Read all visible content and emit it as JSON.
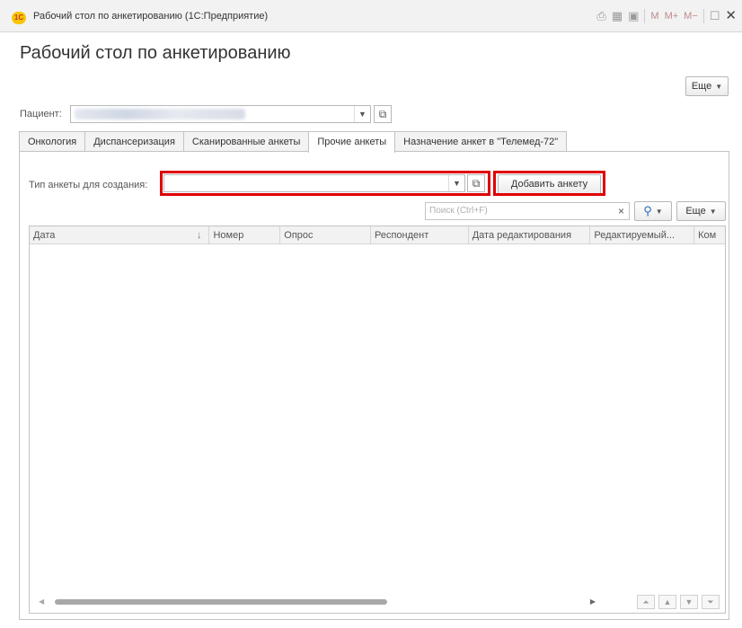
{
  "window": {
    "title": "Рабочий стол по анкетированию  (1С:Предприятие)",
    "logo": "1С",
    "toolbar_m": [
      "M",
      "M+",
      "M−"
    ]
  },
  "page": {
    "title": "Рабочий стол по анкетированию",
    "more_label": "Еще"
  },
  "patient": {
    "label": "Пациент:",
    "value": ""
  },
  "tabs": [
    {
      "label": "Онкология"
    },
    {
      "label": "Диспансеризация"
    },
    {
      "label": "Сканированные анкеты"
    },
    {
      "label": "Прочие анкеты",
      "active": true
    },
    {
      "label": "Назначение анкет в \"Телемед-72\""
    }
  ],
  "form": {
    "type_label": "Тип анкеты для создания:",
    "type_value": "",
    "add_button": "Добавить анкету",
    "search_placeholder": "Поиск (Ctrl+F)",
    "clear_icon": "×",
    "more_label": "Еще"
  },
  "table": {
    "columns": [
      "Дата",
      "Номер",
      "Опрос",
      "Респондент",
      "Дата редактирования",
      "Редактируемый...",
      "Ком"
    ],
    "rows": []
  },
  "colors": {
    "highlight": "#e00000"
  }
}
